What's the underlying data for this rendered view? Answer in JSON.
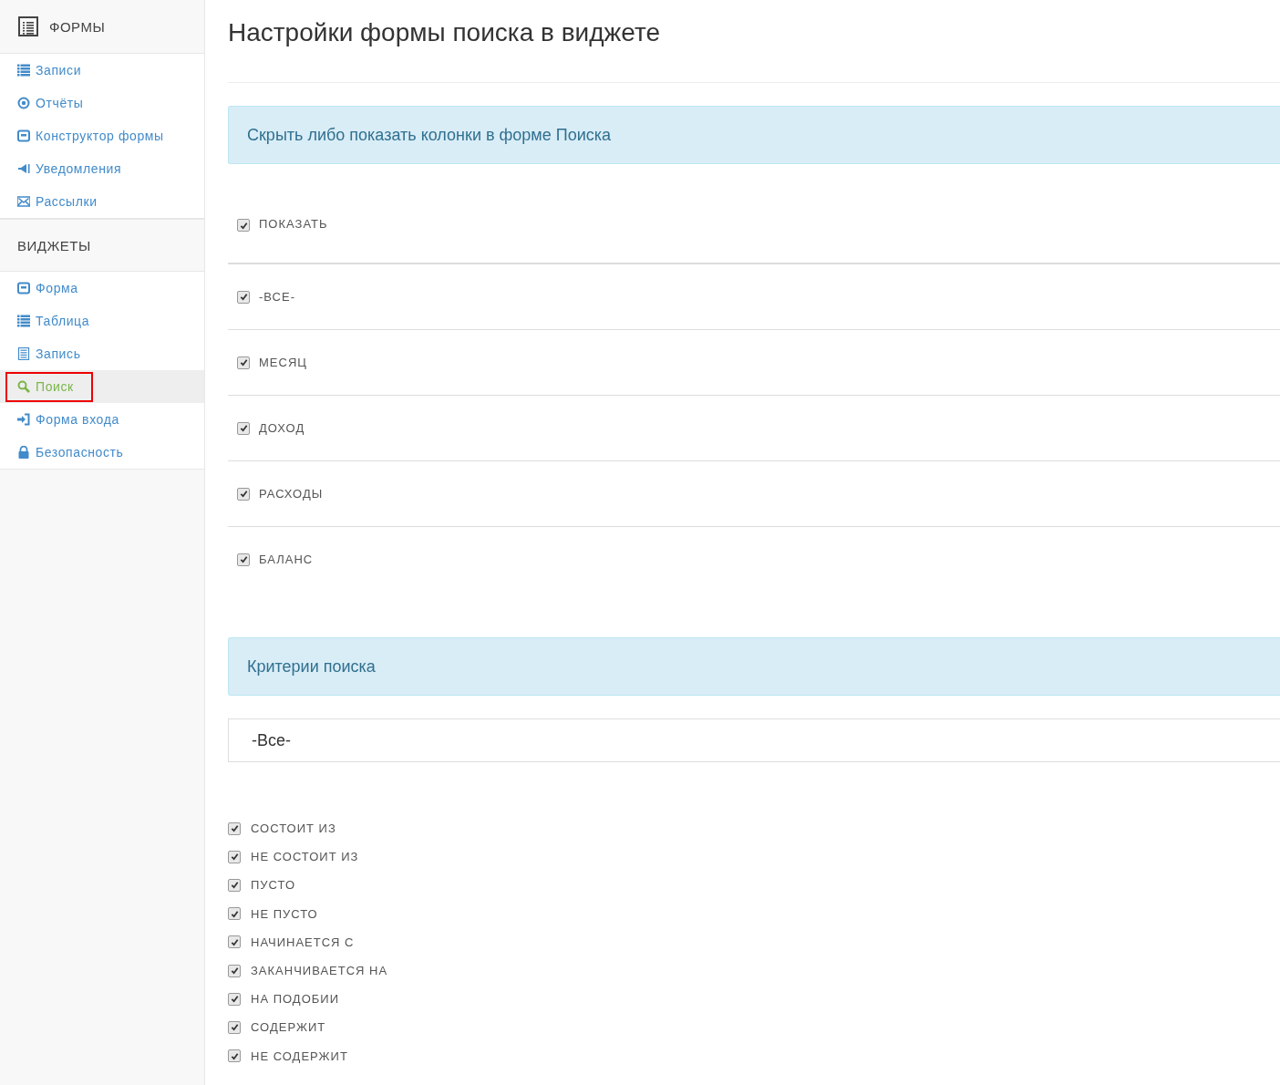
{
  "sidebar": {
    "sections": [
      {
        "title": "ФОРМЫ",
        "items": [
          {
            "label": "Записи",
            "kind": "list",
            "selected": false,
            "highlighted": false
          },
          {
            "label": "Отчёты",
            "kind": "target",
            "selected": false,
            "highlighted": false
          },
          {
            "label": "Конструктор формы",
            "kind": "form",
            "selected": false,
            "highlighted": false
          },
          {
            "label": "Уведомления",
            "kind": "megaphone",
            "selected": false,
            "highlighted": false
          },
          {
            "label": "Рассылки",
            "kind": "envelope",
            "selected": false,
            "highlighted": false
          }
        ]
      },
      {
        "title": "ВИДЖЕТЫ",
        "items": [
          {
            "label": "Форма",
            "kind": "form",
            "selected": false,
            "highlighted": false
          },
          {
            "label": "Таблица",
            "kind": "list",
            "selected": false,
            "highlighted": false
          },
          {
            "label": "Запись",
            "kind": "document",
            "selected": false,
            "highlighted": false
          },
          {
            "label": "Поиск",
            "kind": "search",
            "selected": true,
            "highlighted": true
          },
          {
            "label": "Форма входа",
            "kind": "login",
            "selected": false,
            "highlighted": false
          },
          {
            "label": "Безопасность",
            "kind": "lock",
            "selected": false,
            "highlighted": false
          }
        ]
      }
    ]
  },
  "page_title": "Настройки формы поиска в виджете",
  "columns_panel": {
    "heading": "Скрыть либо показать колонки в форме Поиска",
    "options": [
      {
        "label": "ПОКАЗАТЬ",
        "checked": true
      },
      {
        "label": "-ВСЕ-",
        "checked": true
      },
      {
        "label": "МЕСЯЦ",
        "checked": true
      },
      {
        "label": "ДОХОД",
        "checked": true
      },
      {
        "label": "РАСХОДЫ",
        "checked": true
      },
      {
        "label": "БАЛАНС",
        "checked": true
      }
    ]
  },
  "criteria_panel": {
    "heading": "Критерии поиска",
    "select_value": "-Все-",
    "options": [
      {
        "label": "СОСТОИТ ИЗ",
        "checked": true
      },
      {
        "label": "НЕ СОСТОИТ ИЗ",
        "checked": true
      },
      {
        "label": "ПУСТО",
        "checked": true
      },
      {
        "label": "НЕ ПУСТО",
        "checked": true
      },
      {
        "label": "НАЧИНАЕТСЯ С",
        "checked": true
      },
      {
        "label": "ЗАКАНЧИВАЕТСЯ НА",
        "checked": true
      },
      {
        "label": "НА ПОДОБИИ",
        "checked": true
      },
      {
        "label": "СОДЕРЖИТ",
        "checked": true
      },
      {
        "label": "НЕ СОДЕРЖИТ",
        "checked": true
      }
    ]
  }
}
